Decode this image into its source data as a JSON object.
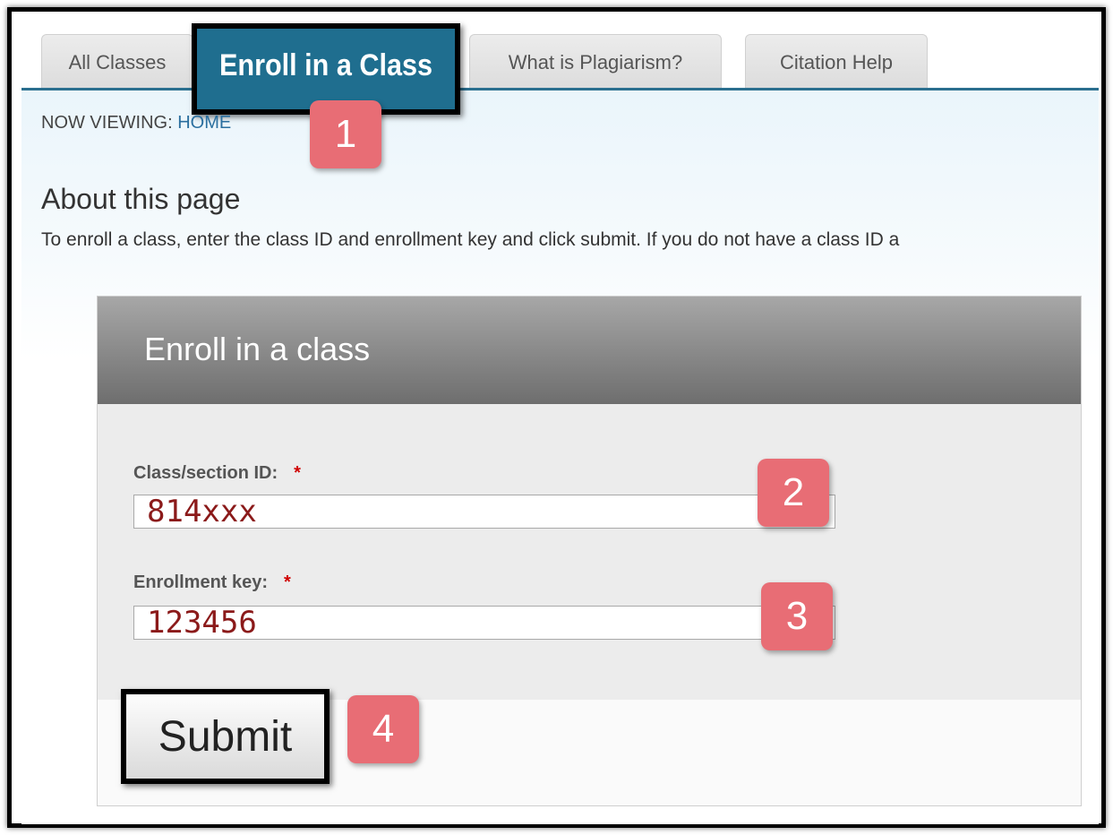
{
  "tabs": [
    {
      "label": "All Classes"
    },
    {
      "label": "Enroll in a Class",
      "active": true
    },
    {
      "label": "What is Plagiarism?"
    },
    {
      "label": "Citation Help"
    }
  ],
  "breadcrumb": {
    "prefix": "NOW VIEWING:",
    "current": "HOME"
  },
  "about": {
    "title": "About this page",
    "text": "To enroll a class, enter the class ID and enrollment key and click submit. If you do not have a class ID a"
  },
  "panel": {
    "title": "Enroll in a class",
    "class_id_label": "Class/section ID:",
    "class_id_value": "814xxx",
    "key_label": "Enrollment key:",
    "key_value": "123456",
    "required_mark": "*",
    "submit_label": "Submit"
  },
  "badges": [
    "1",
    "2",
    "3",
    "4"
  ],
  "colors": {
    "tab_active": "#1f6e8f",
    "badge": "#e86d75",
    "link": "#2b6f9f",
    "required": "#d00000"
  }
}
